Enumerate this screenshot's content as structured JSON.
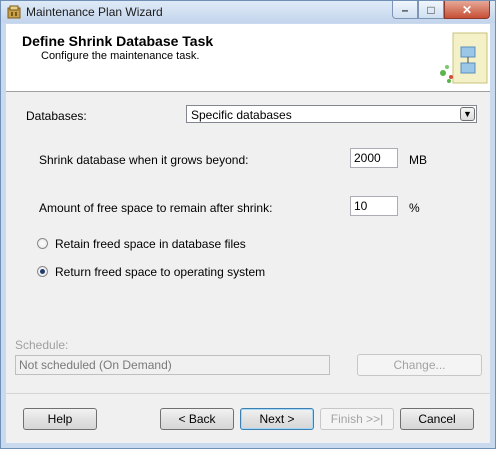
{
  "window": {
    "title": "Maintenance Plan Wizard"
  },
  "header": {
    "title": "Define Shrink Database Task",
    "subtitle": "Configure the maintenance task."
  },
  "databases": {
    "label": "Databases:",
    "selected": "Specific databases"
  },
  "shrink": {
    "grows_label": "Shrink database when it grows beyond:",
    "grows_value": "2000",
    "grows_unit": "MB",
    "free_label": "Amount of free space to remain after shrink:",
    "free_value": "10",
    "free_unit": "%"
  },
  "options": {
    "retain_label": "Retain freed space in database files",
    "retain_selected": false,
    "return_label": "Return freed space to operating system",
    "return_selected": true
  },
  "schedule": {
    "label": "Schedule:",
    "value": "Not scheduled (On Demand)",
    "change_label": "Change..."
  },
  "footer": {
    "help": "Help",
    "back": "< Back",
    "next": "Next >",
    "finish": "Finish >>|",
    "cancel": "Cancel"
  },
  "icons": {
    "app": "wizard-icon",
    "header_art": "maintenance-plan-art-icon"
  }
}
